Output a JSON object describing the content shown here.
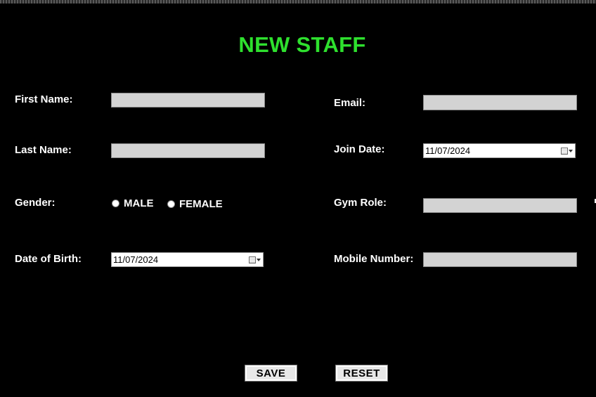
{
  "form": {
    "title": "NEW STAFF",
    "first_name_label": "First Name:",
    "last_name_label": "Last Name:",
    "gender_label": "Gender:",
    "gender_options": [
      "MALE",
      "FEMALE"
    ],
    "dob_label": "Date of Birth:",
    "dob_value": "11/07/2024",
    "email_label": "Email:",
    "join_date_label": "Join Date:",
    "join_date_value": "11/07/2024",
    "gym_role_label": "Gym Role:",
    "mobile_label": "Mobile Number:",
    "save_label": "SAVE",
    "reset_label": "RESET"
  },
  "colors": {
    "background": "#000000",
    "title": "#2ee02e",
    "field": "#d3d3d3"
  },
  "icons": {
    "date_picker": "calendar-icon",
    "dropdown": "chevron-down-icon"
  }
}
